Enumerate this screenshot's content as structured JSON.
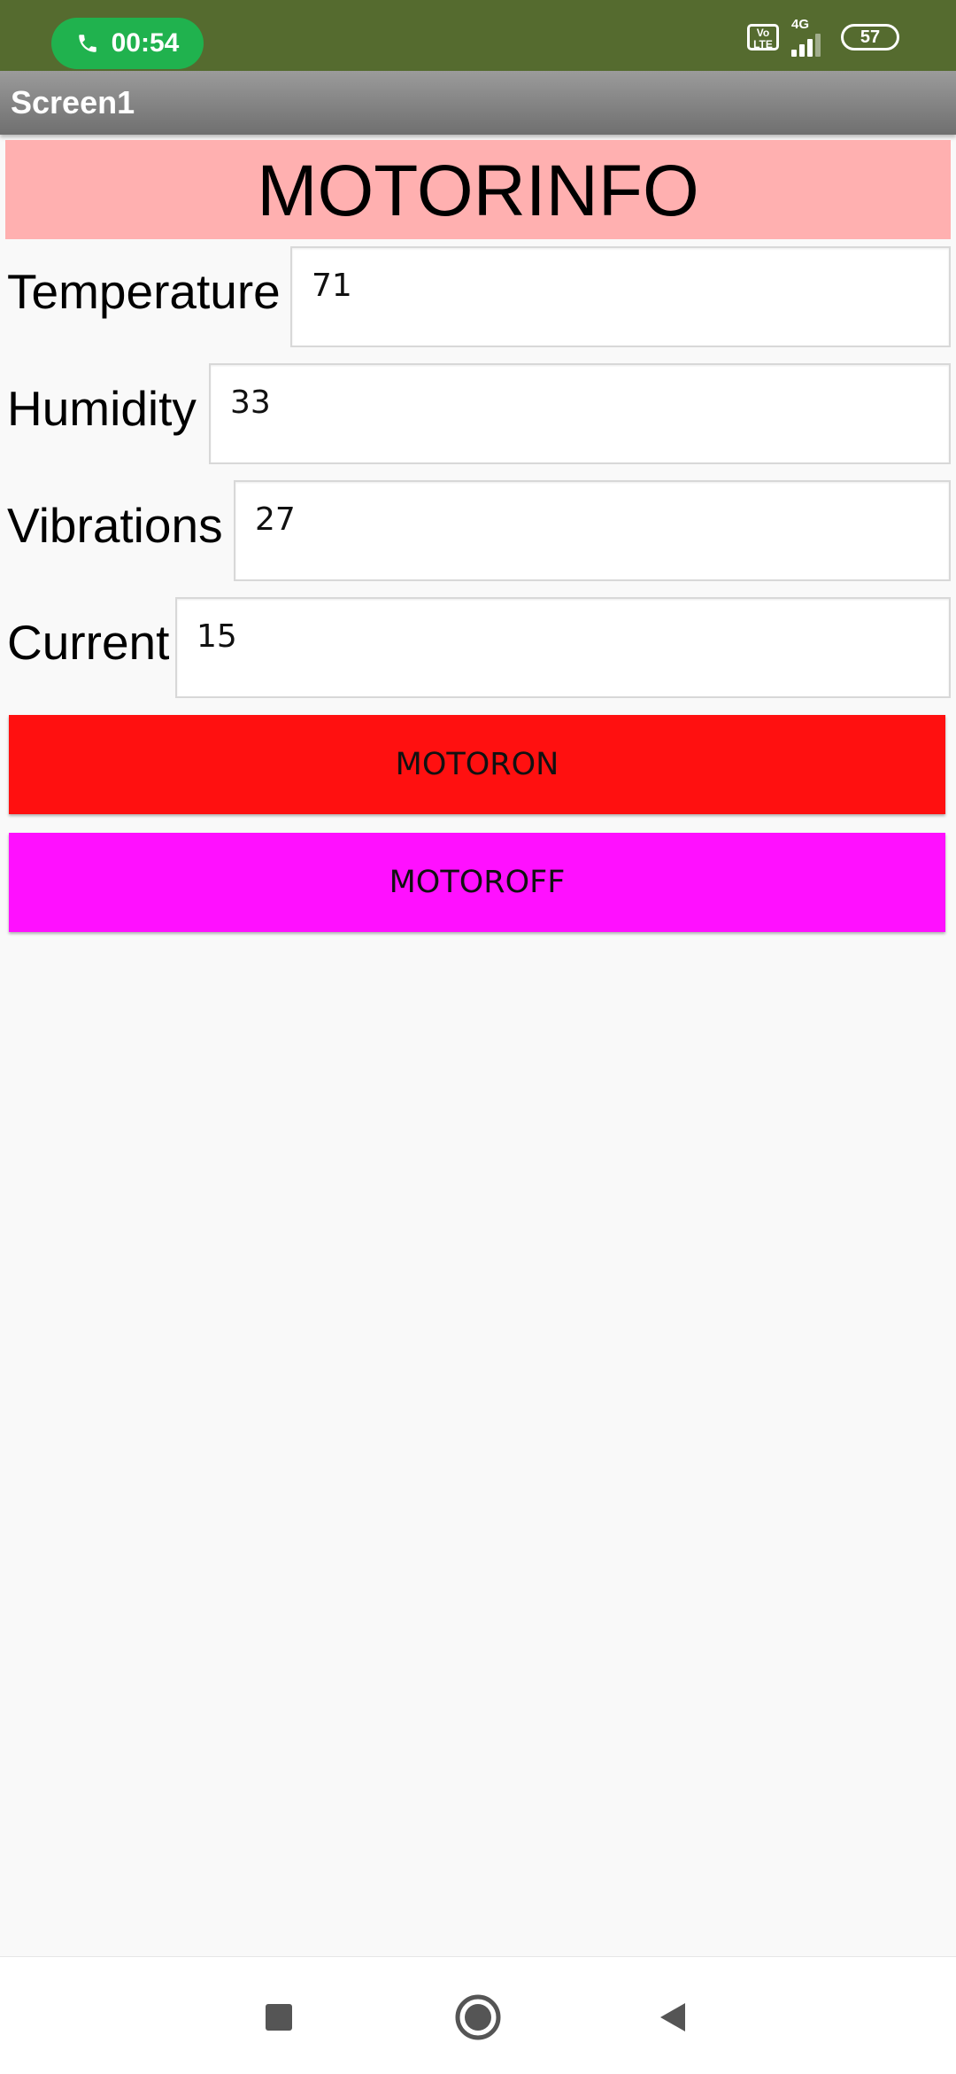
{
  "status_bar": {
    "call_timer": "00:54",
    "volte_text": "Vo LTE",
    "network_type": "4G",
    "battery_level": "57",
    "background_color": "#556b2f",
    "call_pill_color": "#20b24e"
  },
  "title_bar": {
    "title": "Screen1"
  },
  "main": {
    "banner_text": "MOTORINFO",
    "banner_color": "#ffb0b0",
    "fields": [
      {
        "label": "Temperature",
        "value": "71"
      },
      {
        "label": "Humidity",
        "value": "33"
      },
      {
        "label": "Vibrations",
        "value": "27"
      },
      {
        "label": "Current",
        "value": "15"
      }
    ],
    "buttons": {
      "motor_on_label": "MOTORON",
      "motor_on_color": "#ff1010",
      "motor_off_label": "MOTOROFF",
      "motor_off_color": "#ff10ff"
    }
  },
  "nav_bar": {
    "icons": [
      "recents-icon",
      "home-icon",
      "back-icon"
    ]
  }
}
